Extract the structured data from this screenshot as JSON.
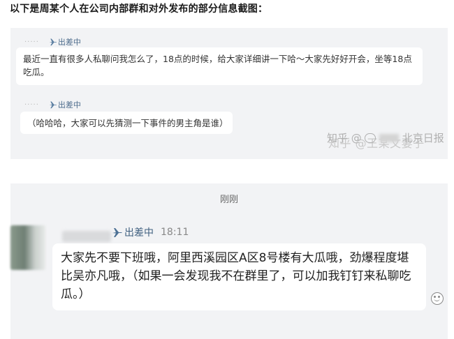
{
  "caption": "以下是周某个人在公司内部群和对外发布的部分信息截图：",
  "panel1": {
    "messages": [
      {
        "status": "出差中",
        "text": "最近一直有很多人私聊问我怎么了，18点的时候，给大家详细讲一下哈～大家先好好开会，坐等18点吃瓜。"
      },
      {
        "status": "出差中",
        "text": "（哈哈哈，大家可以先猜测一下事件的男主角是谁）"
      }
    ],
    "watermark": "知乎 @王某文妻子"
  },
  "panel2": {
    "time_divider": "刚刚",
    "status": "出差中",
    "time": "18:11",
    "message": "大家先不要下班哦，阿里西溪园区A区8号楼有大瓜哦，劲爆程度堪比吴亦凡哦，（如果一会发现我不在群里了，可以加我钉钉来私聊吃瓜。）",
    "watermark_prefix": "知乎 @",
    "watermark_suffix": "北京日报"
  }
}
